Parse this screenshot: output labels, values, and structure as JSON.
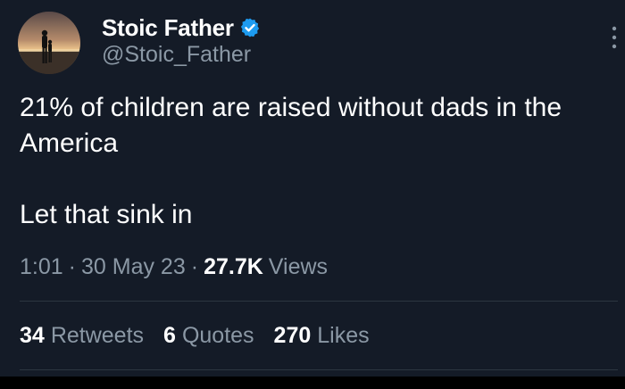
{
  "author": {
    "display_name": "Stoic Father",
    "handle": "@Stoic_Father",
    "verified": true,
    "avatar": "sunset-silhouette-avatar"
  },
  "tweet": {
    "text": "21% of children are raised without dads in the America\n\nLet that sink in",
    "time": "1:01",
    "date": "30 May 23",
    "views_count": "27.7K",
    "views_label": "Views"
  },
  "stats": {
    "retweets_count": "34",
    "retweets_label": "Retweets",
    "quotes_count": "6",
    "quotes_label": "Quotes",
    "likes_count": "270",
    "likes_label": "Likes"
  },
  "colors": {
    "background": "#141b27",
    "text_primary": "#ffffff",
    "text_secondary": "#8b98a5",
    "verified_badge": "#1d9bf0",
    "divider": "#2c3640"
  },
  "icons": {
    "verified": "verified-badge-icon",
    "more": "more-options-icon"
  }
}
